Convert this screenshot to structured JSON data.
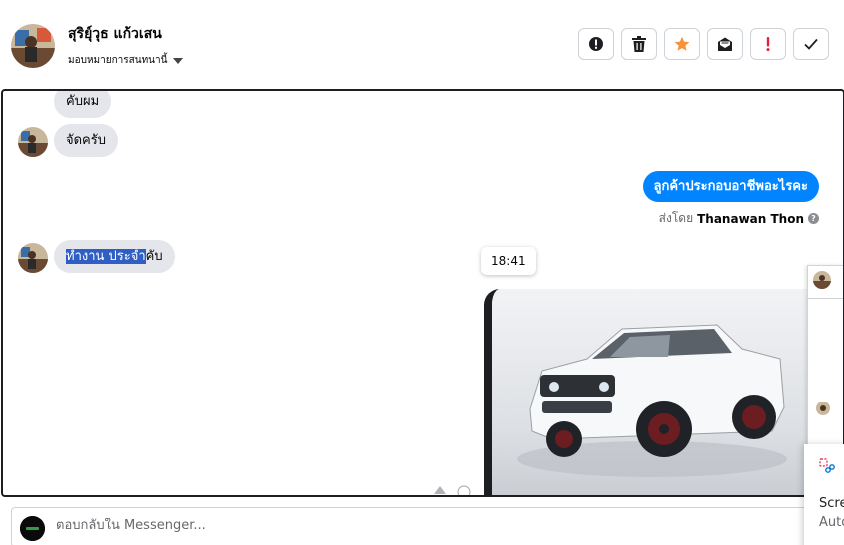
{
  "header": {
    "contact_name": "สุริยุ์วุธ แก้วเสน",
    "assign_label": "มอบหมายการสนทนานี้"
  },
  "toolbar": {
    "buttons": [
      {
        "name": "mark-spam-button",
        "icon": "alert-circle-icon"
      },
      {
        "name": "delete-button",
        "icon": "trash-icon"
      },
      {
        "name": "star-button",
        "icon": "star-icon",
        "color": "#f7923b"
      },
      {
        "name": "mark-unread-button",
        "icon": "envelope-icon"
      },
      {
        "name": "follow-up-button",
        "icon": "exclamation-icon",
        "color": "#e41e3f"
      },
      {
        "name": "mark-done-button",
        "icon": "check-icon"
      }
    ]
  },
  "conversation": {
    "messages": [
      {
        "from": "contact",
        "text": "คับผม"
      },
      {
        "from": "contact",
        "text": "จัดครับ"
      },
      {
        "from": "page",
        "text": "ลูกค้าประกอบอาชีพอะไรคะ"
      },
      {
        "from": "contact",
        "text_highlighted": "ทำงาน ประจำ",
        "text_rest": "คับ"
      }
    ],
    "sent_by_label": "ส่งโดย",
    "sent_by_name": "Thanawan Thon",
    "timestamp": "18:41",
    "bubble_color": "#e4e6eb",
    "sent_color": "#0084ff"
  },
  "reply": {
    "placeholder": "ตอบกลับใน Messenger..."
  },
  "snip_overlay": {
    "title": "Scre",
    "subtitle": "Auto"
  }
}
